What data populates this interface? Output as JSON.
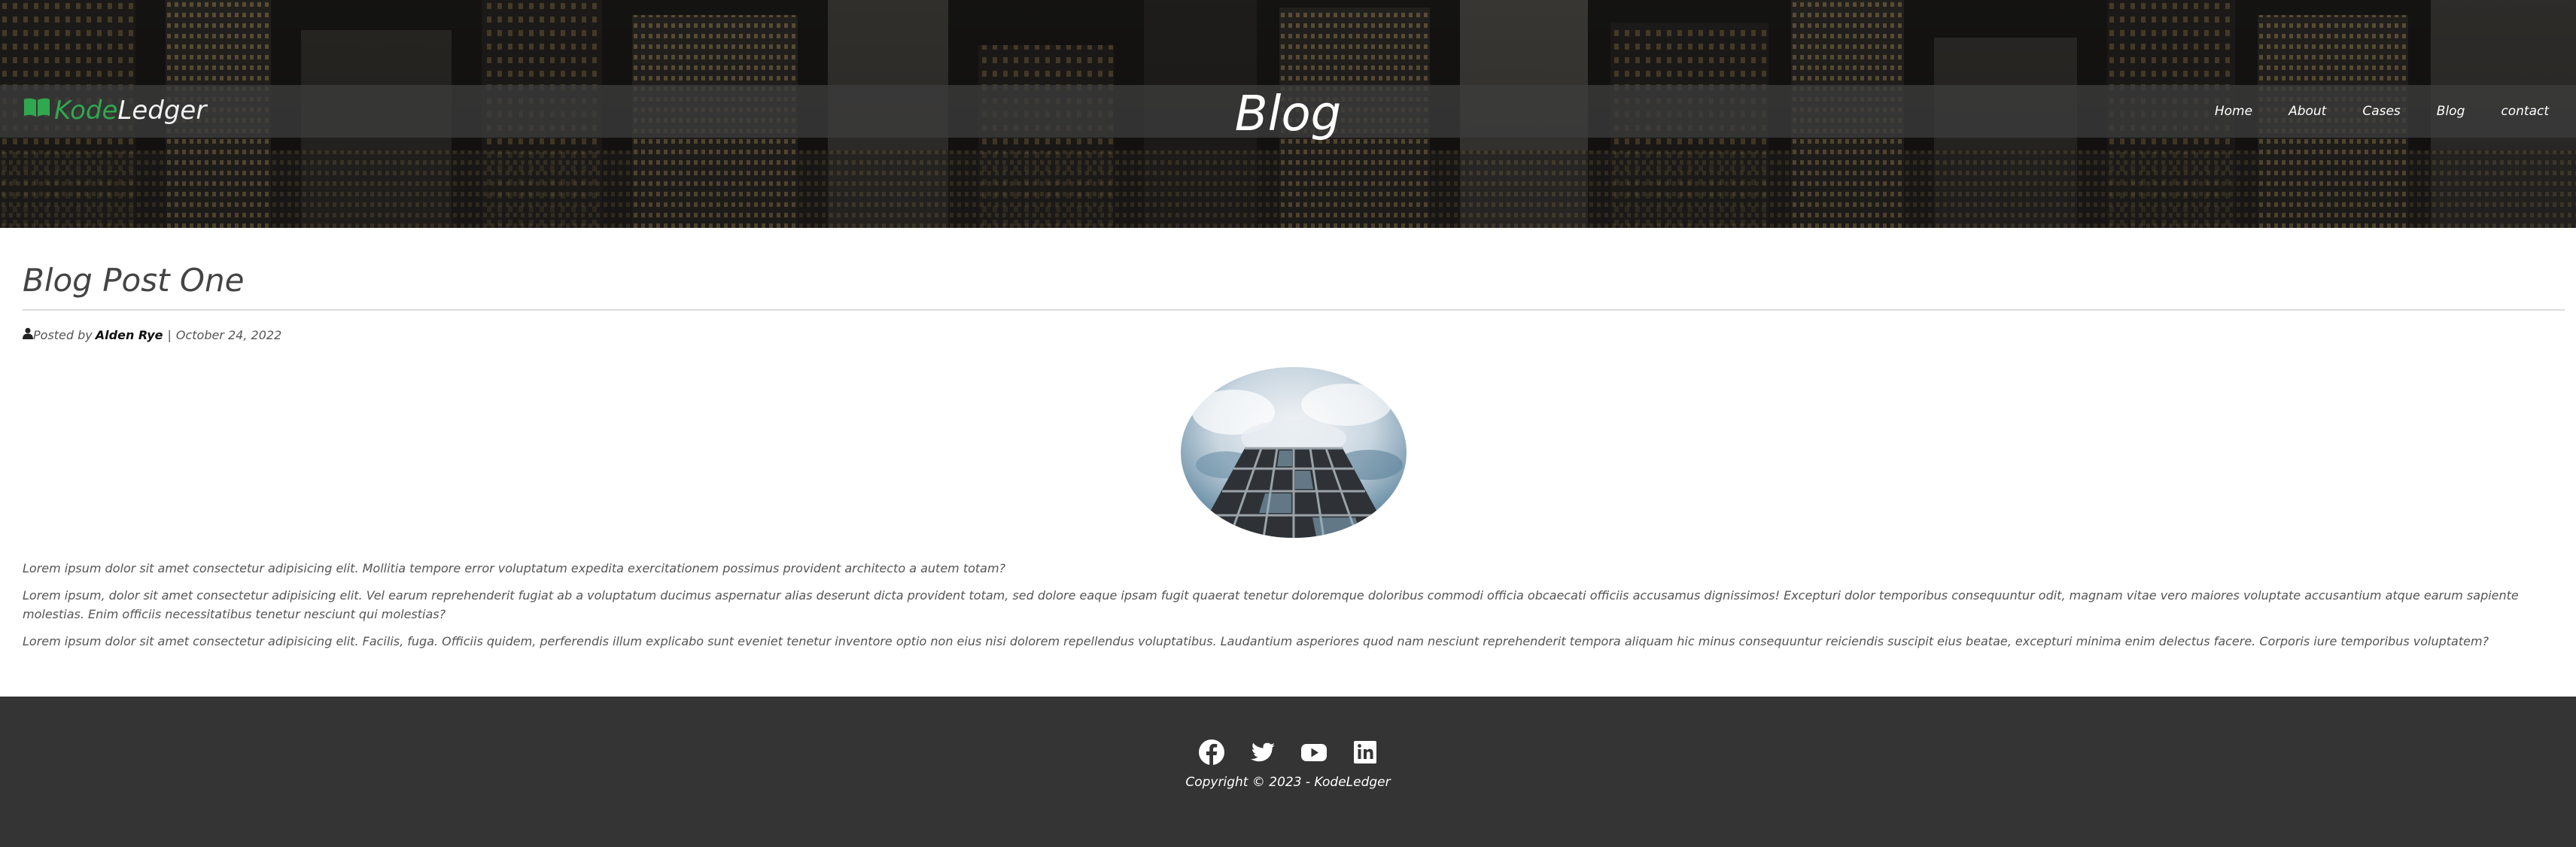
{
  "brand": {
    "part1": "Kode",
    "part2": "Ledger"
  },
  "header": {
    "title": "Blog"
  },
  "nav": {
    "items": [
      "Home",
      "About",
      "Cases",
      "Blog",
      "contact"
    ]
  },
  "post": {
    "title": "Blog Post One",
    "meta_prefix": "Posted by",
    "author": "Alden Rye",
    "separator": "|",
    "date": "October 24, 2022",
    "paragraphs": [
      "Lorem ipsum dolor sit amet consectetur adipisicing elit. Mollitia tempore error voluptatum expedita exercitationem possimus provident architecto a autem totam?",
      "Lorem ipsum, dolor sit amet consectetur adipisicing elit. Vel earum reprehenderit fugiat ab a voluptatum ducimus aspernatur alias deserunt dicta provident totam, sed dolore eaque ipsam fugit quaerat tenetur doloremque doloribus commodi officia obcaecati officiis accusamus dignissimos! Excepturi dolor temporibus consequuntur odit, magnam vitae vero maiores voluptate accusantium atque earum sapiente molestias. Enim officiis necessitatibus tenetur nesciunt qui molestias?",
      "Lorem ipsum dolor sit amet consectetur adipisicing elit. Facilis, fuga. Officiis quidem, perferendis illum explicabo sunt eveniet tenetur inventore optio non eius nisi dolorem repellendus voluptatibus. Laudantium asperiores quod nam nesciunt reprehenderit tempora aliquam hic minus consequuntur reiciendis suscipit eius beatae, excepturi minima enim delectus facere. Corporis iure temporibus voluptatem?"
    ]
  },
  "footer": {
    "socials": [
      "facebook-icon",
      "twitter-icon",
      "youtube-icon",
      "linkedin-icon"
    ],
    "copyright": "Copyright © 2023 - KodeLedger"
  },
  "colors": {
    "brand_green": "#2fa84f",
    "nav_bar": "#3c3c3c",
    "footer_bg": "#343434"
  }
}
